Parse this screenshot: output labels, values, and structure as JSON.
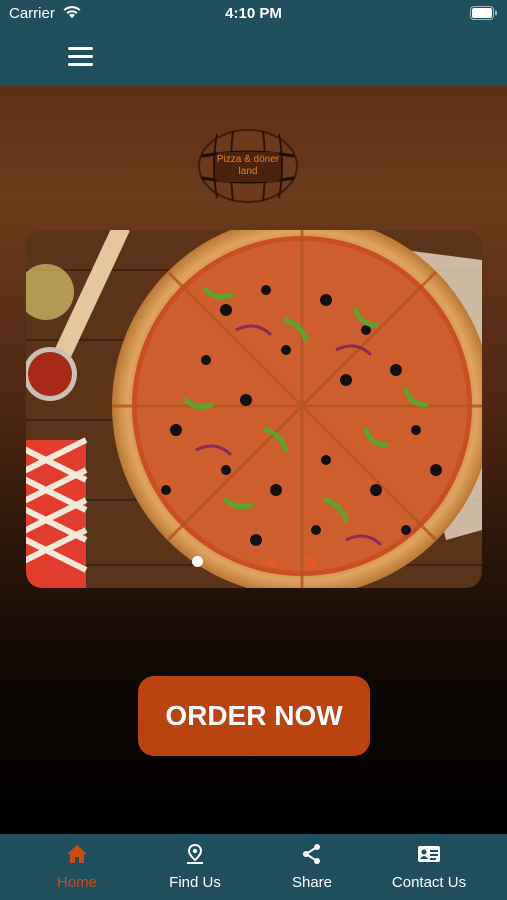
{
  "status_bar": {
    "carrier": "Carrier",
    "time": "4:10 PM",
    "icons": [
      "wifi-icon",
      "battery-icon"
    ]
  },
  "nav": {
    "menu_icon": "hamburger-menu-icon"
  },
  "logo": {
    "line1": "Pizza & döner",
    "line2": "land",
    "text_color": "#e5811e"
  },
  "slider": {
    "image": "pizza-photo",
    "slide_count": 3,
    "active_index": 0,
    "dot_colors": {
      "active": "#ffffff",
      "inactive": "#e25a2a"
    }
  },
  "main": {
    "order_label": "ORDER NOW",
    "order_color": "#b9440f"
  },
  "tabs": [
    {
      "label": "Home",
      "icon": "home-icon",
      "active": true
    },
    {
      "label": "Find Us",
      "icon": "map-pin-icon",
      "active": false
    },
    {
      "label": "Share",
      "icon": "share-icon",
      "active": false
    },
    {
      "label": "Contact Us",
      "icon": "contact-card-icon",
      "active": false
    }
  ],
  "colors": {
    "bar": "#1f4e5c",
    "active_tab": "#cc4a16",
    "inactive_tab": "#ffffff"
  }
}
